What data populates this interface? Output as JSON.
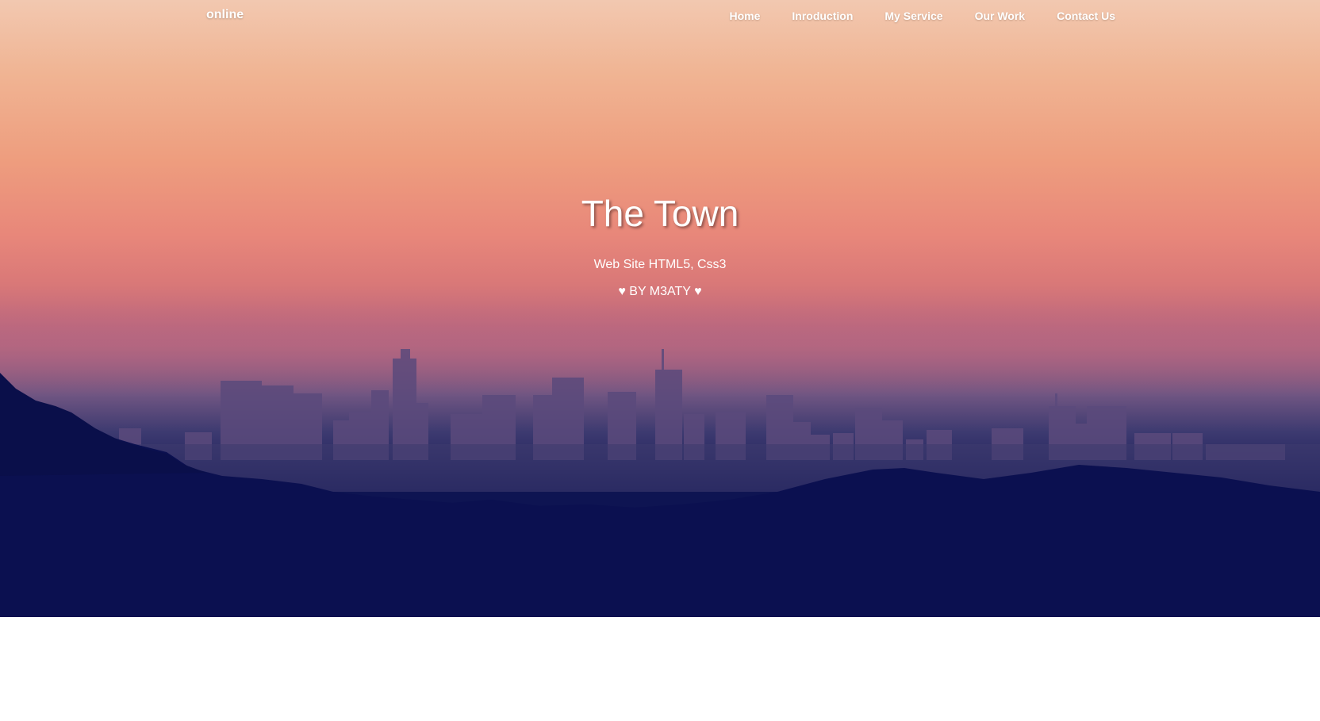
{
  "header": {
    "brand": "online",
    "nav": [
      {
        "label": "Home"
      },
      {
        "label": "Inroduction"
      },
      {
        "label": "My Service"
      },
      {
        "label": "Our Work"
      },
      {
        "label": "Contact Us"
      }
    ]
  },
  "hero": {
    "title": "The Town",
    "subtitle": "Web Site HTML5, Css3",
    "byline": "♥ BY M3ATY ♥"
  },
  "colors": {
    "sky_top": "#f2c8b0",
    "sky_mid": "#ee9d7e",
    "horizon": "#c06a7c",
    "ground": "#0a1150",
    "text": "#ffffff"
  }
}
